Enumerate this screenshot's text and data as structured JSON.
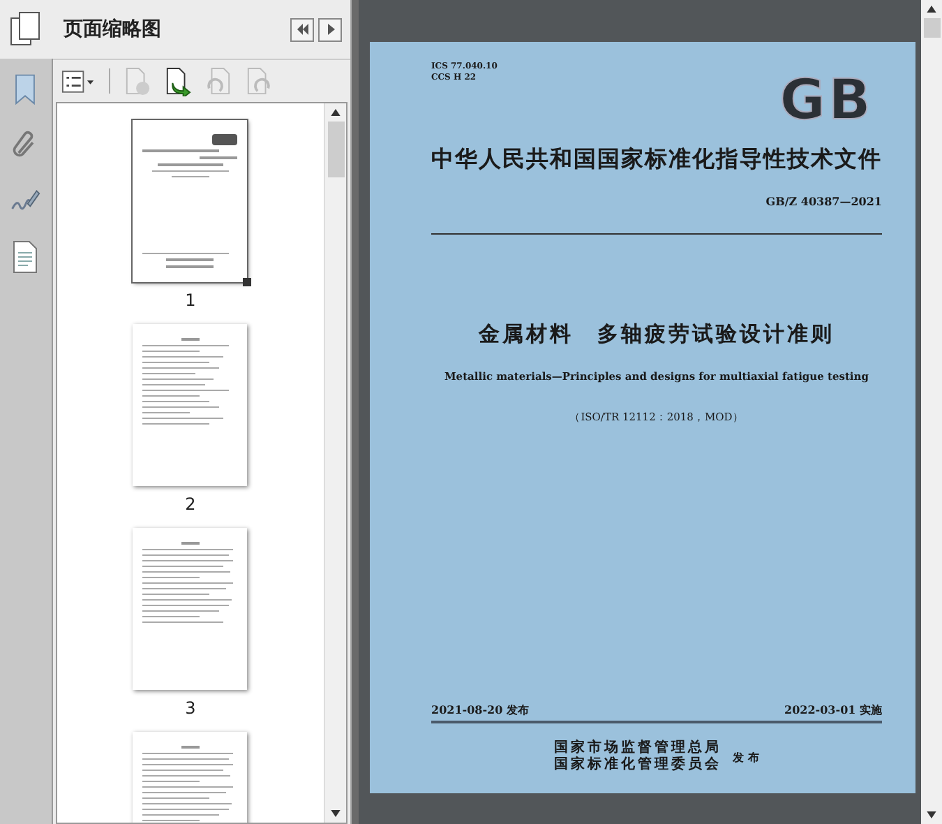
{
  "thumbnail_panel": {
    "title": "页面缩略图",
    "thumbnails": [
      {
        "label": "1",
        "selected": true,
        "kind": "cover"
      },
      {
        "label": "2",
        "selected": false,
        "kind": "contents"
      },
      {
        "label": "3",
        "selected": false,
        "kind": "text"
      },
      {
        "selected": false,
        "kind": "text"
      }
    ]
  },
  "document_page": {
    "classification": [
      "ICS 77.040.10",
      "CCS H 22"
    ],
    "logo": "GB",
    "category": "中华人民共和国国家标准化指导性技术文件",
    "code": "GB/Z 40387—2021",
    "title": "金属材料　多轴疲劳试验设计准则",
    "english_title": "Metallic materials—Principles and designs for multiaxial fatigue testing",
    "adoption": "（ISO/TR 12112：2018，MOD）",
    "issue_date": "2021-08-20 发布",
    "effective_date": "2022-03-01 实施",
    "issuers": [
      "国家市场监督管理总局",
      "国家标准化管理委员会"
    ],
    "issue_label": "发 布"
  }
}
